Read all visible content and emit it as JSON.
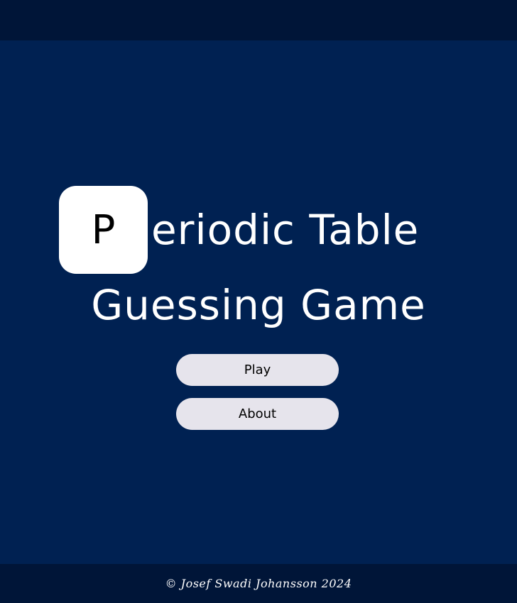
{
  "title": {
    "tile_letter": "P",
    "line1_rest": "eriodic Table",
    "line2": "Guessing Game"
  },
  "menu": {
    "play_label": "Play",
    "about_label": "About"
  },
  "footer": {
    "copyright": "© Josef Swadi Johansson 2024"
  },
  "colors": {
    "background": "#002152",
    "header_footer": "#001538",
    "tile": "#ffffff",
    "button": "#e6e4ec",
    "title_text": "#ffffff"
  }
}
